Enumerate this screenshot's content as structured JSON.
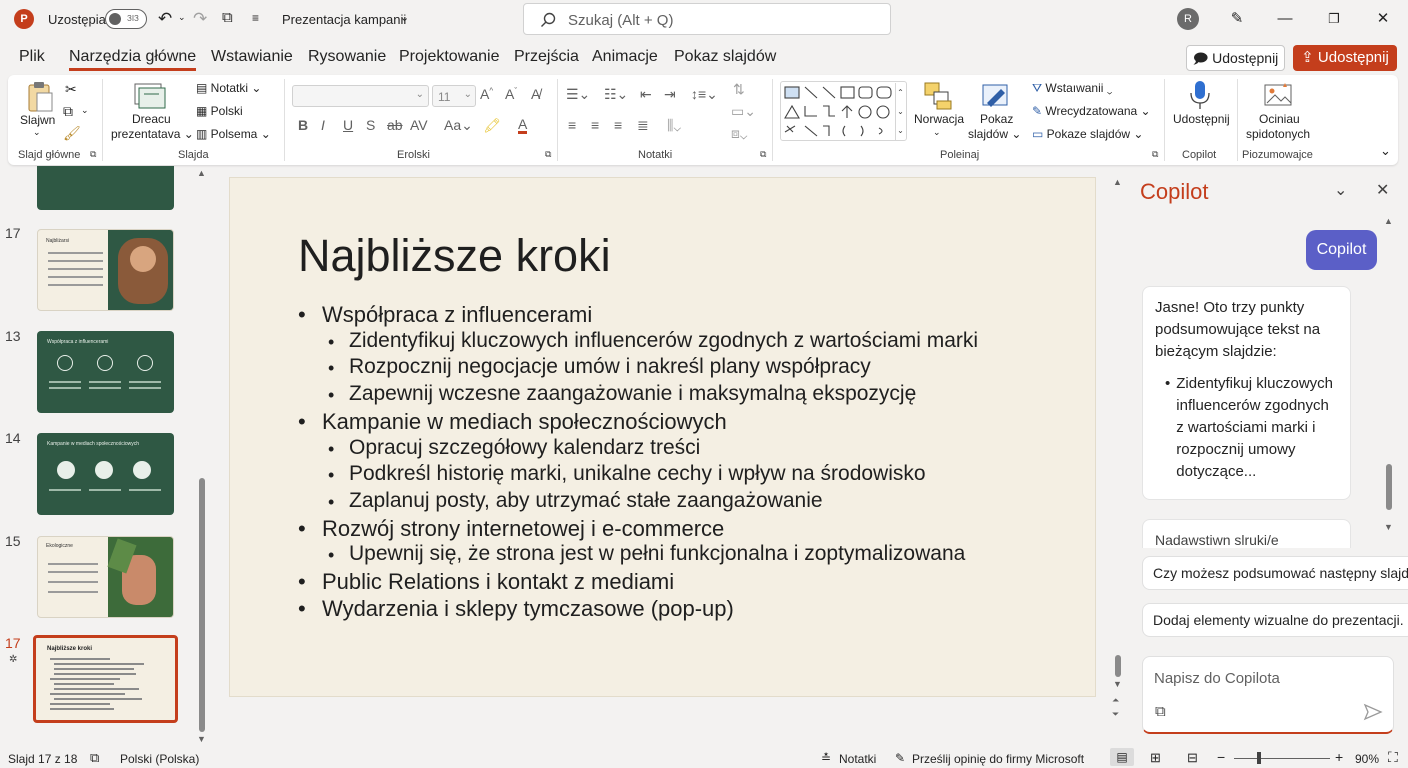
{
  "titlebar": {
    "logo": "P",
    "autosave_label": "Uzostępia",
    "autosave_state": "ЗІЗ",
    "doc_title": "Prezentacja kampanii",
    "search_placeholder": "Szukaj (Alt + Q)",
    "avatar_initial": "R"
  },
  "menu": {
    "items": [
      "Plik",
      "Narzędzia główne",
      "Wstawianie",
      "Rysowanie",
      "Projektowanie",
      "Przejścia",
      "Animacje",
      "Pokaz slajdów"
    ],
    "active": "Narzędzia główne",
    "share_outline": "Udostępnij",
    "share_primary": "Udostępnij"
  },
  "ribbon": {
    "slajdy_btn": "Slajwn",
    "dreacu_btn_1": "Dreacu",
    "dreacu_btn_2": "prezentatava",
    "notatki_btn": "Notatki",
    "polski_btn": "Polski",
    "polsema_btn": "Polsema",
    "font_size": "11",
    "norwacja_btn": "Norwacja",
    "pokaz_btn_1": "Pokaz",
    "pokaz_btn_2": "slajdów",
    "wstawianie_btn": "Wstaıwanii",
    "wrecydzatowana_btn": "Wrecydzatowana",
    "pokaze_btn": "Pokaze slajdów",
    "udostepnij_btn": "Udostępnij",
    "odniau_btn_1": "Ociniau",
    "odniau_btn_2": "spidotonych",
    "groups": {
      "slajd_glowne": "Slajd główne",
      "slajda": "Slajda",
      "erolski": "Erolski",
      "notatki": "Notatki",
      "poleinaj": "Poleinaj",
      "copilot": "Copilot",
      "piozumowajce": "Piozumowajce"
    }
  },
  "thumbnails": [
    {
      "num": "17",
      "title": "Najbliżarsi",
      "style": "light-photo"
    },
    {
      "num": "13",
      "title": "Współpraca z influencerami",
      "style": "green-icons"
    },
    {
      "num": "14",
      "title": "Kampanie w mediach społecznościowych",
      "style": "green-icons"
    },
    {
      "num": "15",
      "title": "Ekologiczne",
      "style": "light-photo2"
    },
    {
      "num": "17",
      "title": "Najbliższe kroki",
      "style": "selected"
    }
  ],
  "slide": {
    "title": "Najbliższe kroki",
    "bullets": [
      {
        "level": 1,
        "text": "Współpraca z influencerami"
      },
      {
        "level": 2,
        "text": "Zidentyfikuj kluczowych influencerów zgodnych z wartościami marki"
      },
      {
        "level": 2,
        "text": "Rozpocznij negocjacje umów i nakreśl plany współpracy"
      },
      {
        "level": 2,
        "text": "Zapewnij wczesne zaangażowanie i maksymalną ekspozycję"
      },
      {
        "level": 1,
        "text": "Kampanie w mediach społecznościowych"
      },
      {
        "level": 2,
        "text": "Opracuj szczegółowy kalendarz treści"
      },
      {
        "level": 2,
        "text": "Podkreśl historię marki, unikalne cechy i wpływ na środowisko"
      },
      {
        "level": 2,
        "text": "Zaplanuj posty, aby utrzymać stałe zaangażowanie"
      },
      {
        "level": 1,
        "text": "Rozwój strony internetowej i e-commerce"
      },
      {
        "level": 2,
        "text": "Upewnij się, że strona jest w pełni funkcjonalna i zoptymalizowana"
      },
      {
        "level": 1,
        "text": "Public Relations i kontakt z mediami"
      },
      {
        "level": 1,
        "text": "Wydarzenia i sklepy tymczasowe (pop-up)"
      }
    ]
  },
  "copilot": {
    "title": "Copilot",
    "user_bubble": "Copilot",
    "response_intro": "Jasne! Oto trzy punkty podsumowujące tekst na bieżącym slajdzie:",
    "response_bullet": "Zidentyfikuj kluczowych influencerów zgodnych z wartościami marki i rozpocznij umowy dotyczące...",
    "cut_text": "Nadawstiwn slruki/e",
    "suggestions": [
      "Czy możesz podsumować następny slajd?",
      "Dodaj elementy wizualne do prezentacji."
    ],
    "input_placeholder": "Napisz do Copilota"
  },
  "status": {
    "slide_count": "Slajd 17 z 18",
    "language": "Polski (Polska)",
    "notes": "Notatki",
    "feedback": "Prześlij opinię do firmy Microsoft",
    "zoom": "90%"
  },
  "colors": {
    "accent": "#c43e1c",
    "copilot_bubble": "#5b5fc7",
    "thumb_green": "#2f5844",
    "slide_bg": "#f4efe3"
  }
}
